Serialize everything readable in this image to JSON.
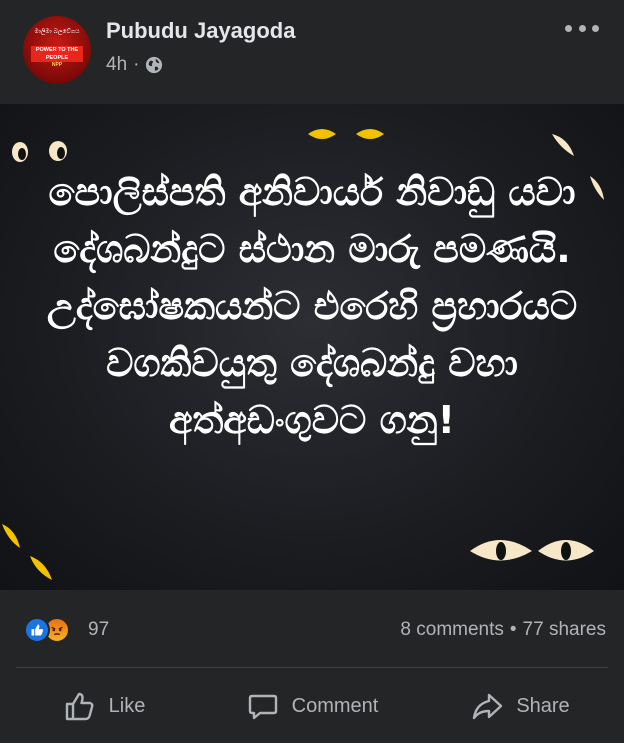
{
  "post": {
    "author": "Pubudu Jayagoda",
    "time": "4h",
    "separator": "·",
    "privacy_icon": "globe-icon",
    "avatar_text": {
      "top": "මාලිමා බලවේගය",
      "slogan": "POWER TO THE PEOPLE",
      "tag": "NPP"
    },
    "image_text": "පොලිස්පති අනිවාර්ය නිවාඩු යවා දේශබන්දුට ස්ථාන මාරු පමණයි. උද්ඝෝෂකයන්ට එරෙහි ප්‍රහාරයට වගකිවයුතු දේශබන්දු වහා අත්අඩංගුවට ගනු!",
    "image_background": "#1b1c20",
    "eye_color": "#f2c200"
  },
  "reactions": {
    "icons": [
      "like-reaction-icon",
      "angry-reaction-icon"
    ],
    "count": "97",
    "comments": "8 comments",
    "dot": "•",
    "shares": "77 shares"
  },
  "actions": {
    "like": "Like",
    "comment": "Comment",
    "share": "Share"
  },
  "colors": {
    "background": "#242526",
    "text_primary": "#e4e6eb",
    "text_secondary": "#b0b3b8",
    "like_blue": "#1b74e4",
    "divider": "#3e4042"
  }
}
